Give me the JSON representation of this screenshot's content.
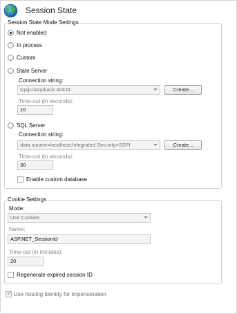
{
  "page": {
    "title": "Session State",
    "icon": "globe-icon"
  },
  "session_mode": {
    "group_label": "Session State Mode Settings",
    "options": [
      {
        "label": "Not enabled",
        "selected": true
      },
      {
        "label": "In process",
        "selected": false
      },
      {
        "label": "Custom",
        "selected": false
      },
      {
        "label": "State Server",
        "selected": false
      },
      {
        "label": "SQL Server",
        "selected": false
      }
    ],
    "state_server": {
      "connection_label": "Connection string:",
      "connection_value": "tcpip=loopback:42424",
      "create_label": "Create...",
      "timeout_label": "Time-out (in seconds):",
      "timeout_value": "10"
    },
    "sql_server": {
      "connection_label": "Connection string:",
      "connection_value": "data source=localhost;Integrated Security=SSPI",
      "create_label": "Create...",
      "timeout_label": "Time-out (in seconds):",
      "timeout_value": "30",
      "custom_db_label": "Enable custom database",
      "custom_db_checked": false
    }
  },
  "cookie": {
    "group_label": "Cookie Settings",
    "mode_label": "Mode:",
    "mode_value": "Use Cookies",
    "name_label": "Name:",
    "name_value": "ASP.NET_SessionId",
    "timeout_label": "Time-out (in minutes):",
    "timeout_value": "20",
    "regenerate_label": "Regenerate expired session ID",
    "regenerate_checked": false
  },
  "impersonation": {
    "label": "Use hosting identity for impersonation",
    "checked": true
  },
  "colors": {
    "border": "#d0d0d0",
    "disabled_text": "#8a8a8a",
    "field_bg": "#f4f4f4"
  }
}
